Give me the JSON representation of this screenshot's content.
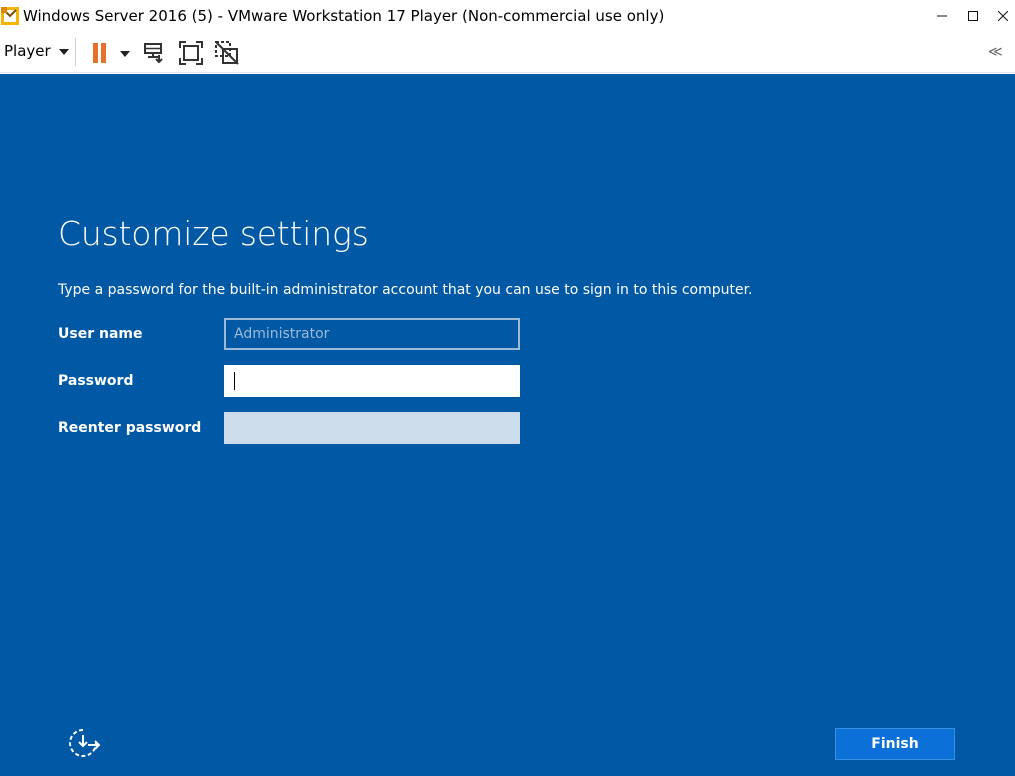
{
  "window": {
    "title": "Windows Server 2016 (5) - VMware Workstation 17 Player (Non-commercial use only)",
    "minimize_glyph": "—",
    "maximize_glyph": "☐",
    "close_glyph": "✕"
  },
  "toolbar": {
    "player_label": "Player",
    "icons": [
      "pause-icon",
      "send-ctrl-alt-del-icon",
      "fullscreen-icon",
      "unity-icon",
      "collapse-toolbar-icon"
    ],
    "collapse_glyph": "≪"
  },
  "setup": {
    "heading": "Customize settings",
    "description": "Type a password for the built-in administrator account that you can use to sign in to this computer.",
    "username_label": "User name",
    "username_placeholder": "Administrator",
    "password_label": "Password",
    "password_value": "",
    "reenter_label": "Reenter password",
    "reenter_value": "",
    "finish_label": "Finish"
  },
  "colors": {
    "vm_background": "#0158a4",
    "accent_button": "#0b71d8",
    "pause_orange": "#e8712a"
  }
}
